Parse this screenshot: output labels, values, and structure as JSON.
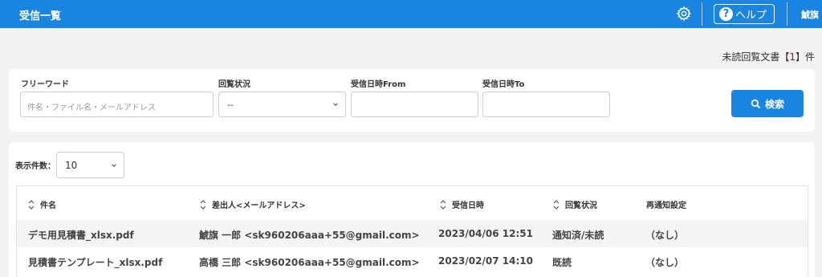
{
  "header": {
    "title": "受信一覧",
    "help_label": "ヘルプ",
    "help_symbol": "?",
    "user_name": "鯱旗",
    "icons": [
      "gear-icon",
      "help-icon"
    ],
    "colors": {
      "bar": "#1a85e0",
      "text": "#ffffff"
    }
  },
  "unread": {
    "prefix": "未読回覧文書【",
    "count": "1",
    "suffix": "】件"
  },
  "search": {
    "freeword_label": "フリーワード",
    "freeword_placeholder": "件名・ファイル名・メールアドレス",
    "status_label": "回覧状況",
    "status_value": "--",
    "from_label": "受信日時From",
    "to_label": "受信日時To",
    "button_label": "検索",
    "button_icon": "search-icon"
  },
  "list": {
    "per_page_label": "表示件数：",
    "per_page_value": "10",
    "columns": [
      "件名",
      "差出人<メールアドレス>",
      "受信日時",
      "回覧状況",
      "再通知設定"
    ],
    "rows": [
      {
        "subject": "デモ用見積書_xlsx.pdf",
        "sender": "鯱旗 一郎 <sk960206aaa+55@gmail.com>",
        "received": "2023/04/06 12:51",
        "status": "通知済/未読",
        "renotify": "（なし）"
      },
      {
        "subject": "見積書テンプレート_xlsx.pdf",
        "sender": "高橋 三郎 <sk960206aaa+55@gmail.com>",
        "received": "2023/02/07 14:10",
        "status": "既読",
        "renotify": "（なし）"
      }
    ]
  }
}
